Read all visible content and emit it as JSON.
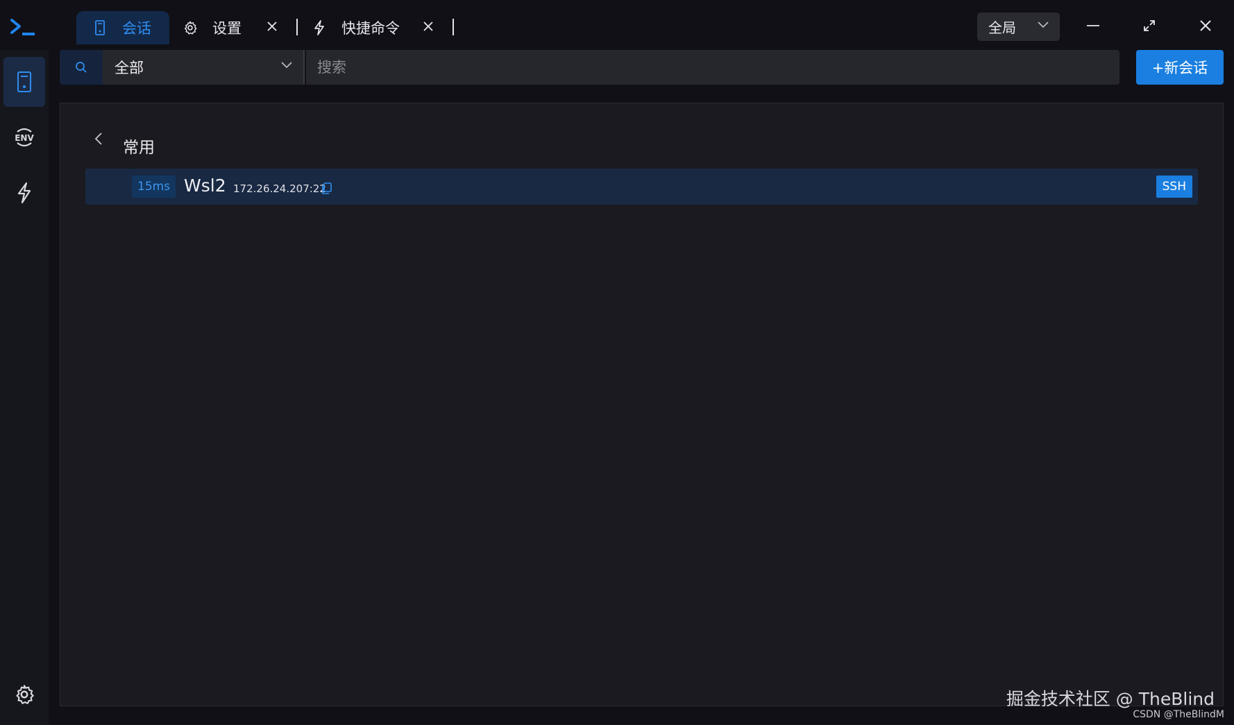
{
  "tabs": [
    {
      "label": "会话",
      "icon": "session-icon",
      "active": true
    },
    {
      "label": "设置",
      "icon": "gear-icon",
      "active": false
    },
    {
      "label": "快捷命令",
      "icon": "lightning-icon",
      "active": false
    }
  ],
  "window": {
    "scope_select": "全局"
  },
  "rail": {
    "items": [
      {
        "icon": "session-icon",
        "active": true
      },
      {
        "icon": "env-icon",
        "active": false
      },
      {
        "icon": "lightning-icon",
        "active": false
      }
    ],
    "bottom_icon": "gear-icon"
  },
  "toolbar": {
    "group_select": "全部",
    "search_placeholder": "搜索",
    "new_session_label": "+新会话"
  },
  "group": {
    "title": "常用"
  },
  "sessions": [
    {
      "latency": "15ms",
      "name": "Wsl2",
      "host": "172.26.24.207:22",
      "protocol": "SSH"
    }
  ],
  "watermark": {
    "main": "掘金技术社区 @ TheBlind",
    "sub": "CSDN @TheBlindM"
  },
  "colors": {
    "accent": "#1a7fe0",
    "background": "#101016",
    "panel": "#1a1a20"
  }
}
